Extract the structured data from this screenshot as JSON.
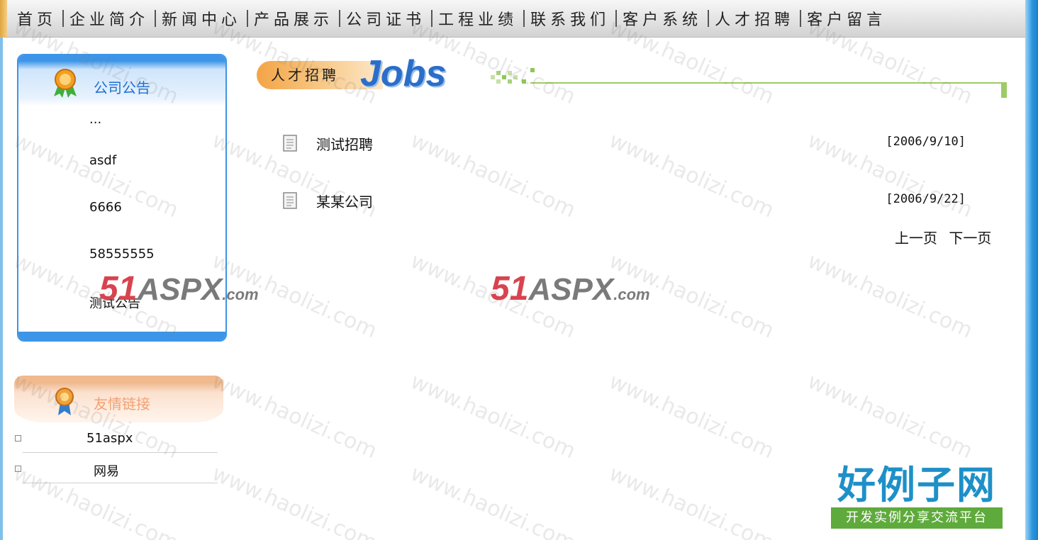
{
  "nav": {
    "items": [
      "首页",
      "企业简介",
      "新闻中心",
      "产品展示",
      "公司证书",
      "工程业绩",
      "联系我们",
      "客户系统",
      "人才招聘",
      "客户留言"
    ]
  },
  "sidebar": {
    "notice": {
      "title": "公司公告",
      "items": [
        "...",
        "asdf",
        "6666",
        "58555555",
        "测试公告"
      ]
    },
    "links": {
      "title": "友情链接",
      "items": [
        "51aspx",
        "网易"
      ]
    }
  },
  "main": {
    "section_label": "人才招聘",
    "section_word": "Jobs",
    "jobs": [
      {
        "title": "测试招聘",
        "date": "[2006/9/10]"
      },
      {
        "title": "某某公司",
        "date": "[2006/9/22]"
      }
    ],
    "pager": {
      "prev": "上一页",
      "next": "下一页"
    }
  },
  "watermark": {
    "text": "www.haolizi.com",
    "logo_number": "51",
    "logo_word": "ASPX",
    "logo_suffix": ".com"
  },
  "brand": {
    "name": "好例子网",
    "slogan": "开发实例分享交流平台"
  },
  "colors": {
    "nav_bg": "#e3e3e3",
    "notice_accent": "#3d95e8",
    "links_accent": "#f0b98e",
    "jobs_blue": "#2b6ec9",
    "line_green": "#9ccb67",
    "brand_blue": "#1e90c8",
    "brand_green": "#5faa3c"
  }
}
